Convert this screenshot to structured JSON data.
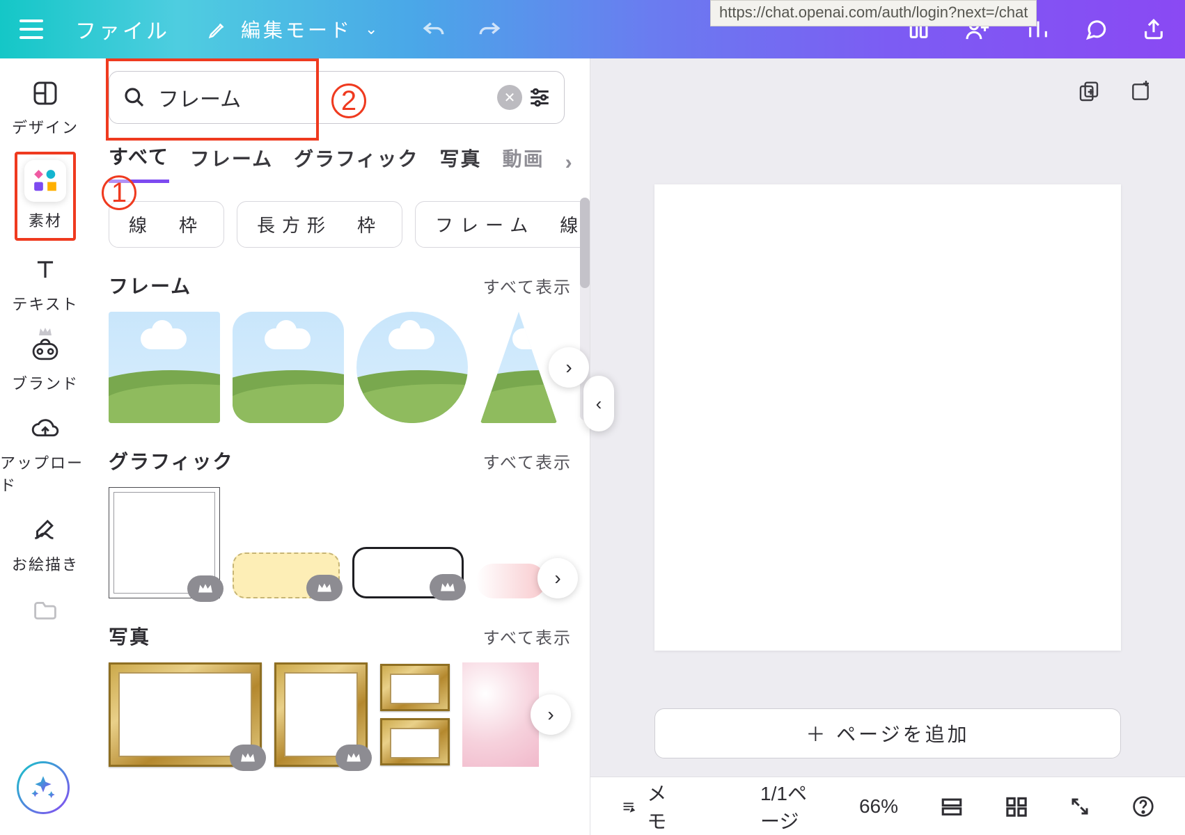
{
  "url_hint": "https://chat.openai.com/auth/login?next=/chat",
  "topbar": {
    "file_label": "ファイル",
    "mode_label": "編集モード"
  },
  "rail": {
    "design": "デザイン",
    "elements": "素材",
    "text": "テキスト",
    "brand": "ブランド",
    "upload": "アップロード",
    "draw": "お絵描き"
  },
  "annotations": {
    "one": "1",
    "two": "2"
  },
  "panel": {
    "search_value": "フレーム",
    "tabs": {
      "all": "すべて",
      "frame": "フレーム",
      "graphic": "グラフィック",
      "photo": "写真",
      "video": "動画"
    },
    "chips": {
      "c1": "線　枠",
      "c2": "長方形　枠",
      "c3": "フレーム　線"
    },
    "sections": {
      "frame_title": "フレーム",
      "graphic_title": "グラフィック",
      "photo_title": "写真",
      "show_all": "すべて表示"
    }
  },
  "canvas": {
    "add_page": "＋ ページを追加"
  },
  "bottombar": {
    "memo": "メモ",
    "page_indicator": "1/1ページ",
    "zoom": "66%"
  }
}
